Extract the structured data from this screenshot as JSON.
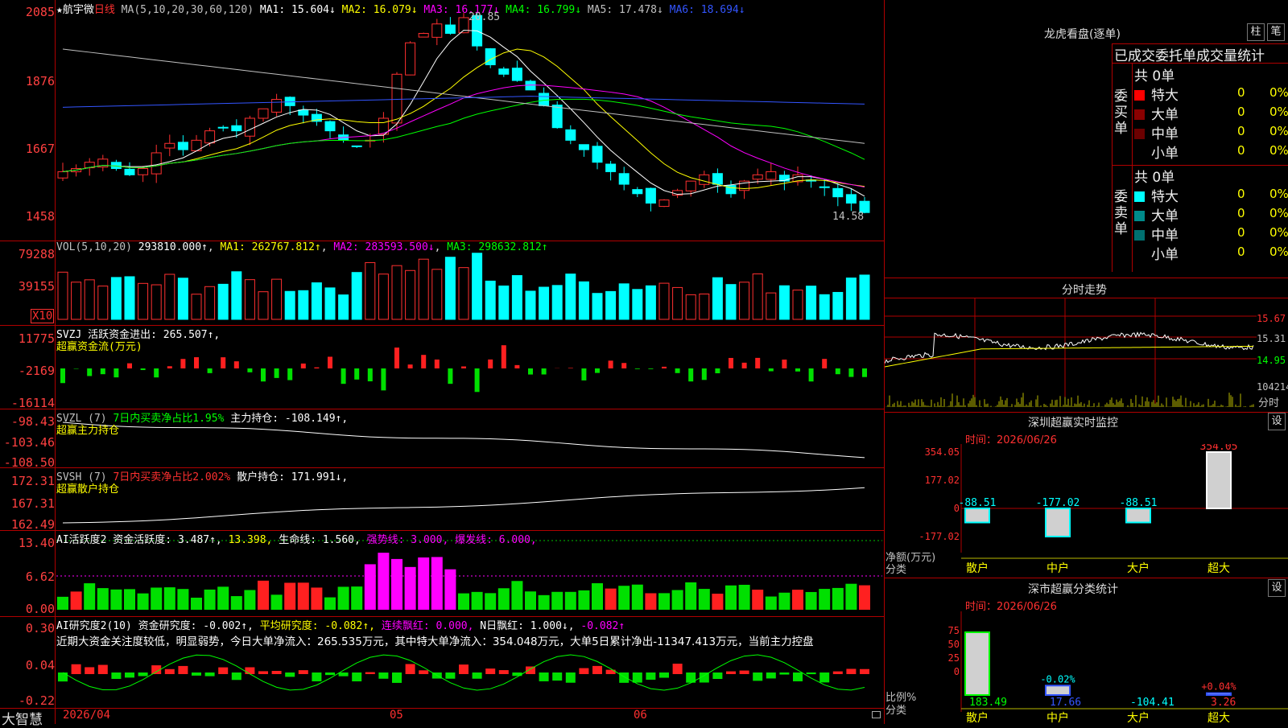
{
  "stock": {
    "name": "★航宇微",
    "period": "日线"
  },
  "main": {
    "ma_label": "MA(5,10,20,30,60,120)",
    "ma1": "MA1: 15.604↓",
    "ma2": "MA2: 16.079↓",
    "ma3": "MA3: 16.177↓",
    "ma4": "MA4: 16.799↓",
    "ma5": "MA5: 17.478↓",
    "ma6": "MA6: 18.694↓",
    "high_mark": "20.85",
    "low_mark": "14.58",
    "yaxis": [
      "2085",
      "1876",
      "1667",
      "1458"
    ]
  },
  "vol": {
    "label": "VOL(5,10,20)",
    "value": "293810.000↑",
    "ma1": "MA1: 262767.812↑",
    "ma2": "MA2: 283593.500↓",
    "ma3": "MA3: 298632.812↑",
    "yaxis": [
      "79288",
      "39155"
    ],
    "unit": "X10"
  },
  "svzj": {
    "label": "SVZJ  活跃资金进出: 265.507↑,",
    "sub": "超赢资金流(万元)",
    "yaxis": [
      "11775",
      "-2169",
      "-16114"
    ]
  },
  "svzl": {
    "label": "SVZL (7)",
    "pct": "7日内买卖净占比1.95%",
    "hold": "主力持仓: -108.149↑,",
    "sub": "超赢主力持仓",
    "yaxis": [
      "-98.43",
      "-103.46",
      "-108.50"
    ]
  },
  "svsh": {
    "label": "SVSH (7)",
    "pct": "7日内买卖净占比2.002%",
    "hold": "散户持仓: 171.991↓,",
    "sub": "超赢散户持仓",
    "yaxis": [
      "172.31",
      "167.31",
      "162.49"
    ]
  },
  "ai1": {
    "label": "AI活跃度2 资金活跃度: 3.487↑,",
    "v2": "13.398,",
    "v3": "生命线: 1.560,",
    "v4": "强势线: 3.000,",
    "v5": "爆发线: 6.000,",
    "yaxis": [
      "13.40",
      "6.62",
      "0.00"
    ]
  },
  "ai2": {
    "label": "AI研究度2(10) 资金研究度: -0.002↑,",
    "v2": "平均研究度: -0.082↑,",
    "v3": "连续飘红: 0.000,",
    "v4": "N日飘红: 1.000↓,",
    "v5": "-0.082↑",
    "note": "近期大资金关注度较低，明显弱势，今日大单净流入：265.535万元，其中特大单净流入：354.048万元，大单5日累计净出-11347.413万元，当前主力控盘",
    "yaxis": [
      "0.30",
      "0.04",
      "-0.22"
    ]
  },
  "xaxis": {
    "start": "2026/04",
    "m5": "05",
    "m6": "06"
  },
  "brand": "大智慧",
  "lhb": {
    "title": "龙虎看盘(逐单)",
    "btn_zhu": "柱",
    "btn_bi": "笔",
    "header": "已成交委托单成交量统计",
    "buy_label": "委买单",
    "buy_total": "共 0单",
    "buy_rows": [
      {
        "name": "特大",
        "n": "0",
        "p": "0%",
        "color": "#ff0000"
      },
      {
        "name": "大单",
        "n": "0",
        "p": "0%",
        "color": "#8b0000"
      },
      {
        "name": "中单",
        "n": "0",
        "p": "0%",
        "color": "#6b0000"
      },
      {
        "name": "小单",
        "n": "0",
        "p": "0%",
        "color": "#000000"
      }
    ],
    "sell_label": "委卖单",
    "sell_total": "共 0单",
    "sell_rows": [
      {
        "name": "特大",
        "n": "0",
        "p": "0%",
        "color": "#00ffff"
      },
      {
        "name": "大单",
        "n": "0",
        "p": "0%",
        "color": "#008b8b"
      },
      {
        "name": "中单",
        "n": "0",
        "p": "0%",
        "color": "#007070"
      },
      {
        "name": "小单",
        "n": "0",
        "p": "0%",
        "color": "#000000"
      }
    ]
  },
  "fenshi": {
    "title": "分时走势",
    "yaxis": [
      "15.67",
      "15.31",
      "14.95",
      "104214"
    ],
    "vol_label": "分时"
  },
  "monitor": {
    "title": "深圳超赢实时监控",
    "btn": "设",
    "date": "时间：2026/06/26",
    "yaxis": [
      "354.05",
      "177.02",
      "0",
      "-177.02"
    ],
    "bars": [
      {
        "name": "散户",
        "value": -88.51,
        "label": "-88.51"
      },
      {
        "name": "中户",
        "value": -177.02,
        "label": "-177.02"
      },
      {
        "name": "大户",
        "value": -88.51,
        "label": "-88.51"
      },
      {
        "name": "超大",
        "value": 354.05,
        "label": "354.05"
      }
    ],
    "ylabel": "净额(万元)",
    "xlabel": "分类"
  },
  "stat": {
    "title": "深市超赢分类统计",
    "btn": "设",
    "date": "时间：2026/06/26",
    "yaxis": [
      "75",
      "50",
      "25",
      "0"
    ],
    "bars": [
      {
        "name": "散户",
        "pct": 100,
        "pct_label": "",
        "value": "183.49"
      },
      {
        "name": "中户",
        "pct": 15,
        "pct_label": "-0.02%",
        "value": "17.66"
      },
      {
        "name": "大户",
        "pct": 0,
        "pct_label": "",
        "value": "-104.41"
      },
      {
        "name": "超大",
        "pct": 3,
        "pct_label": "+0.04%",
        "value": "3.26"
      }
    ],
    "ylabel": "比例%",
    "xlabel": "分类"
  }
}
